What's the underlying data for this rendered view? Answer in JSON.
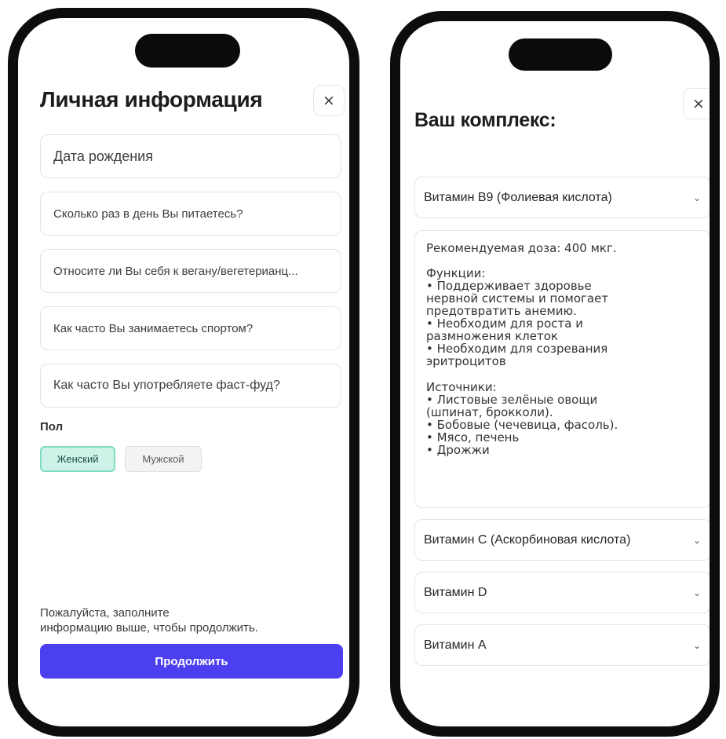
{
  "left_screen": {
    "title": "Личная информация",
    "close_label": "×",
    "fields": [
      {
        "placeholder": "Дата рождения"
      },
      {
        "placeholder": "Сколько раз в день Вы питаетесь?"
      },
      {
        "placeholder": "Относите ли Вы себя к вегану/вегетерианц..."
      },
      {
        "placeholder": "Как часто Вы занимаетесь спортом?"
      },
      {
        "placeholder": "Как часто Вы употребляете фаст-фуд?"
      }
    ],
    "gender": {
      "label": "Пол",
      "options": [
        {
          "label": "Женский",
          "selected": true
        },
        {
          "label": "Мужской",
          "selected": false
        }
      ]
    },
    "hint_lines": [
      "Пожалуйста, заполните",
      "информацию выше, чтобы продолжить."
    ],
    "continue_label": "Продолжить",
    "accent_color": "#4b3ff0",
    "selected_chip_color": "#cdf3e9"
  },
  "right_screen": {
    "title": "Ваш комплекс:",
    "close_label": "×",
    "chevron": "⌄",
    "accordions": [
      {
        "label": "Витамин B9 (Фолиевая кислота)",
        "expanded": true
      },
      {
        "label": "Витамин C (Аскорбиновая кислота)",
        "expanded": false
      },
      {
        "label": "Витамин D",
        "expanded": false
      },
      {
        "label": "Витамин A",
        "expanded": false
      }
    ],
    "details": {
      "dose": "Рекомендуемая доза: 400 мкг.",
      "functions_title": "Функции:",
      "functions_lines": [
        "• Поддерживает здоровье",
        "нервной системы и помогает",
        "предотвратить анемию.",
        "• Необходим для роста и",
        "размножения клеток",
        "• Необходим для созревания",
        "эритроцитов"
      ],
      "sources_title": "Источники:",
      "sources_lines": [
        "• Листовые зелёные овощи",
        "(шпинат, брокколи).",
        "• Бобовые (чечевица, фасоль).",
        "• Мясо, печень",
        "• Дрожжи"
      ]
    }
  }
}
